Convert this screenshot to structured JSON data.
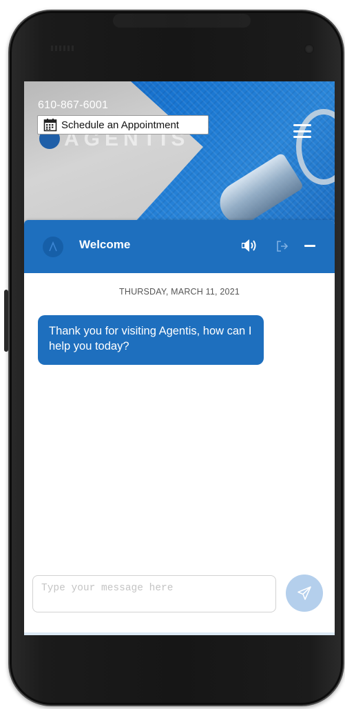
{
  "website": {
    "phone_number": "610-867-6001",
    "appointment_label": "Schedule an Appointment",
    "logo_text": "AGENTIS"
  },
  "chat": {
    "title": "Welcome",
    "date": "THURSDAY, MARCH 11, 2021",
    "messages": [
      {
        "sender": "bot",
        "text": "Thank you for visiting Agentis, how can I help you today?"
      }
    ],
    "input_placeholder": "Type your message here"
  },
  "icons": {
    "calendar": "calendar-icon",
    "menu": "hamburger-menu-icon",
    "avatar": "agentis-logo-icon",
    "sound": "speaker-icon",
    "exit": "exit-icon",
    "minimize": "minimize-icon",
    "send": "send-icon"
  },
  "colors": {
    "brand_blue": "#1e6fbe",
    "send_button": "#b4cfec"
  }
}
